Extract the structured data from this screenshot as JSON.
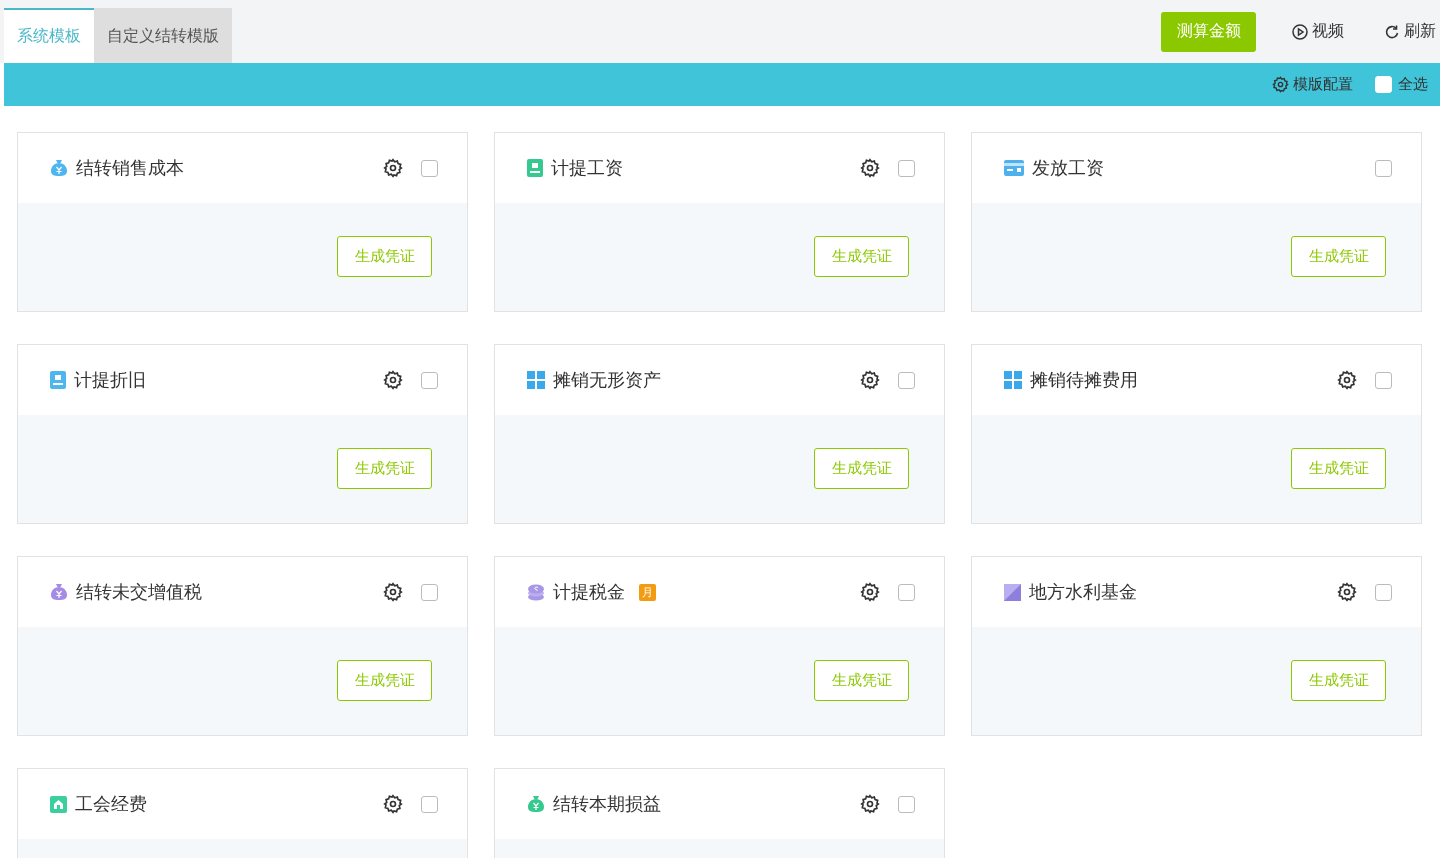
{
  "tabs": [
    {
      "label": "系统模板",
      "selected": true
    },
    {
      "label": "自定义结转模版",
      "selected": false
    }
  ],
  "toolbar": {
    "primary_button": "测算金额",
    "video_link": "视频",
    "refresh_link": "刷新"
  },
  "bar": {
    "config_link": "模版配置",
    "select_all": {
      "label": "全选",
      "checked": false
    }
  },
  "cards": [
    {
      "title": "结转销售成本",
      "settings": true,
      "checked": false,
      "button": "生成凭证"
    },
    {
      "title": "计提工资",
      "settings": true,
      "checked": false,
      "button": "生成凭证"
    },
    {
      "title": "发放工资",
      "settings": false,
      "checked": false,
      "button": "生成凭证"
    },
    {
      "title": "计提折旧",
      "settings": true,
      "checked": false,
      "button": "生成凭证"
    },
    {
      "title": "摊销无形资产",
      "settings": true,
      "checked": false,
      "button": "生成凭证"
    },
    {
      "title": "摊销待摊费用",
      "settings": true,
      "checked": false,
      "button": "生成凭证"
    },
    {
      "title": "结转未交增值税",
      "settings": true,
      "checked": false,
      "button": "生成凭证"
    },
    {
      "title": "计提税金",
      "badge": "月",
      "settings": true,
      "checked": false,
      "button": "生成凭证"
    },
    {
      "title": "地方水利基金",
      "settings": true,
      "checked": false,
      "button": "生成凭证"
    },
    {
      "title": "工会经费",
      "settings": true,
      "checked": false
    },
    {
      "title": "结转本期损益",
      "settings": true,
      "checked": false
    }
  ]
}
